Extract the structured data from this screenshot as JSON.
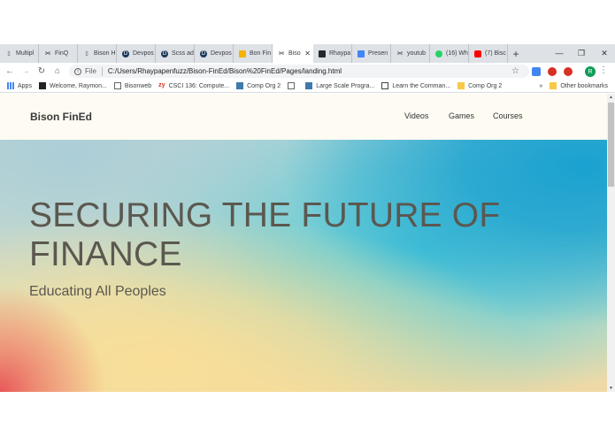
{
  "tabs": [
    {
      "label": "Multipl",
      "icon": "file-icon"
    },
    {
      "label": "FinQ",
      "icon": "bowtie-icon"
    },
    {
      "label": "Bison H",
      "icon": "file-icon"
    },
    {
      "label": "Devpos",
      "icon": "devpost-icon"
    },
    {
      "label": "Scss ad",
      "icon": "devpost-icon"
    },
    {
      "label": "Devpos",
      "icon": "devpost-icon"
    },
    {
      "label": "Bon Fin",
      "icon": "slides-icon"
    },
    {
      "label": "Biso",
      "icon": "bowtie-icon",
      "active": true
    },
    {
      "label": "Rhaypa",
      "icon": "github-icon"
    },
    {
      "label": "Presen",
      "icon": "docs-icon"
    },
    {
      "label": "youtub",
      "icon": "bowtie-icon"
    },
    {
      "label": "(16) Wh",
      "icon": "whatsapp-icon"
    },
    {
      "label": "(7) Bisc",
      "icon": "youtube-icon"
    }
  ],
  "address": {
    "scheme": "File",
    "url": "C:/Users/Rhaypapenfuzz/Bison-FinEd/Bison%20FinEd/Pages/landing.html"
  },
  "avatar_letter": "R",
  "bookmarks": [
    {
      "label": "Apps"
    },
    {
      "label": "Welcome, Raymon..."
    },
    {
      "label": "Bisonweb"
    },
    {
      "label": "CSCI 136: Compute..."
    },
    {
      "label": "Comp Org 2"
    },
    {
      "label": ""
    },
    {
      "label": "Large Scale Progra..."
    },
    {
      "label": "Learn the Comman..."
    },
    {
      "label": "Comp Org 2"
    }
  ],
  "bookmarks_overflow": "»",
  "other_bookmarks": "Other bookmarks",
  "site": {
    "brand": "Bison FinEd",
    "nav": [
      "Videos",
      "Games",
      "Courses"
    ],
    "hero_title": "SECURING THE FUTURE OF FINANCE",
    "hero_subtitle": "Educating All Peoples"
  },
  "colors": {
    "navbar_bg": "#fefbf3",
    "hero_text": "#5b5850",
    "accent_blue": "#1aa1d0",
    "accent_teal": "#4fc8d8",
    "accent_yellow": "#f8de98",
    "accent_red": "#e8585a"
  }
}
